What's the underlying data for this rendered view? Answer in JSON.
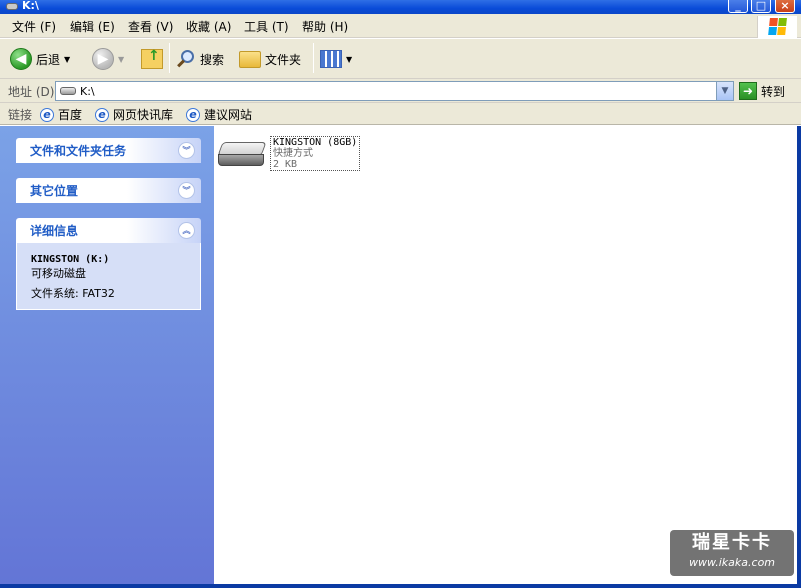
{
  "window": {
    "title": "K:\\",
    "buttons": {
      "min": "_",
      "max": "□",
      "close": "×"
    }
  },
  "menu": [
    "文件 (F)",
    "编辑 (E)",
    "查看 (V)",
    "收藏 (A)",
    "工具 (T)",
    "帮助 (H)"
  ],
  "toolbar": {
    "back_label": "后退",
    "search_label": "搜索",
    "folders_label": "文件夹"
  },
  "address": {
    "label": "地址 (D)",
    "value": "K:\\",
    "go_label": "转到"
  },
  "links": {
    "label": "链接",
    "items": [
      "百度",
      "网页快讯库",
      "建议网站"
    ]
  },
  "sidebar": {
    "panels": [
      {
        "title": "文件和文件夹任务",
        "state": "collapsed"
      },
      {
        "title": "其它位置",
        "state": "collapsed"
      },
      {
        "title": "详细信息",
        "state": "expanded"
      }
    ],
    "details": {
      "name": "KINGSTON (K:)",
      "type": "可移动磁盘",
      "fs": "文件系统: FAT32"
    }
  },
  "main": {
    "items": [
      {
        "name": "KINGSTON (8GB)",
        "type": "快捷方式",
        "size": "2 KB"
      }
    ]
  },
  "watermark": {
    "line1": "瑞星卡卡",
    "line2": "www.ikaka.com"
  },
  "colors": {
    "title_blue": "#0a4bd8",
    "sidebar_blue": "#7ba2e7",
    "panel_text": "#215dc6"
  }
}
